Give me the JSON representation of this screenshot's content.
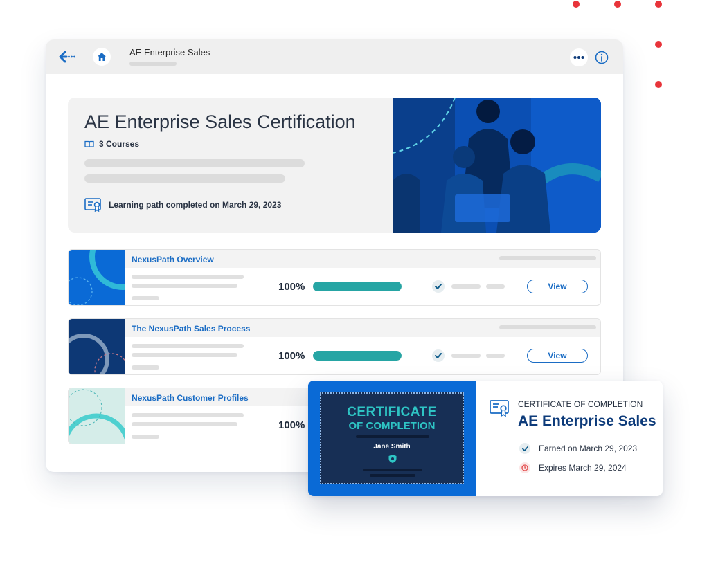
{
  "accent": "#1a6cc4",
  "progress_color": "#26a5a4",
  "window": {
    "title": "AE Enterprise Sales",
    "back_icon": "back-arrow-icon",
    "home_icon": "home-icon",
    "more_icon": "more-icon",
    "info_icon": "info-icon"
  },
  "hero": {
    "title": "AE Enterprise Sales Certification",
    "courses_label": "3 Courses",
    "completed_label": "Learning path completed on March 29, 2023"
  },
  "courses": [
    {
      "title": "NexusPath Overview",
      "progress_label": "100%",
      "progress": 1.0,
      "view_label": "View"
    },
    {
      "title": "The NexusPath Sales Process",
      "progress_label": "100%",
      "progress": 1.0,
      "view_label": "View"
    },
    {
      "title": "NexusPath Customer Profiles",
      "progress_label": "100%",
      "progress": 1.0
    }
  ],
  "certificate": {
    "image_title_line1": "CERTIFICATE",
    "image_title_line2": "OF COMPLETION",
    "recipient": "Jane Smith",
    "heading": "CERTIFICATE OF COMPLETION",
    "title": "AE Enterprise Sales",
    "earned": "Earned on March 29, 2023",
    "expires": "Expires March 29, 2024"
  }
}
